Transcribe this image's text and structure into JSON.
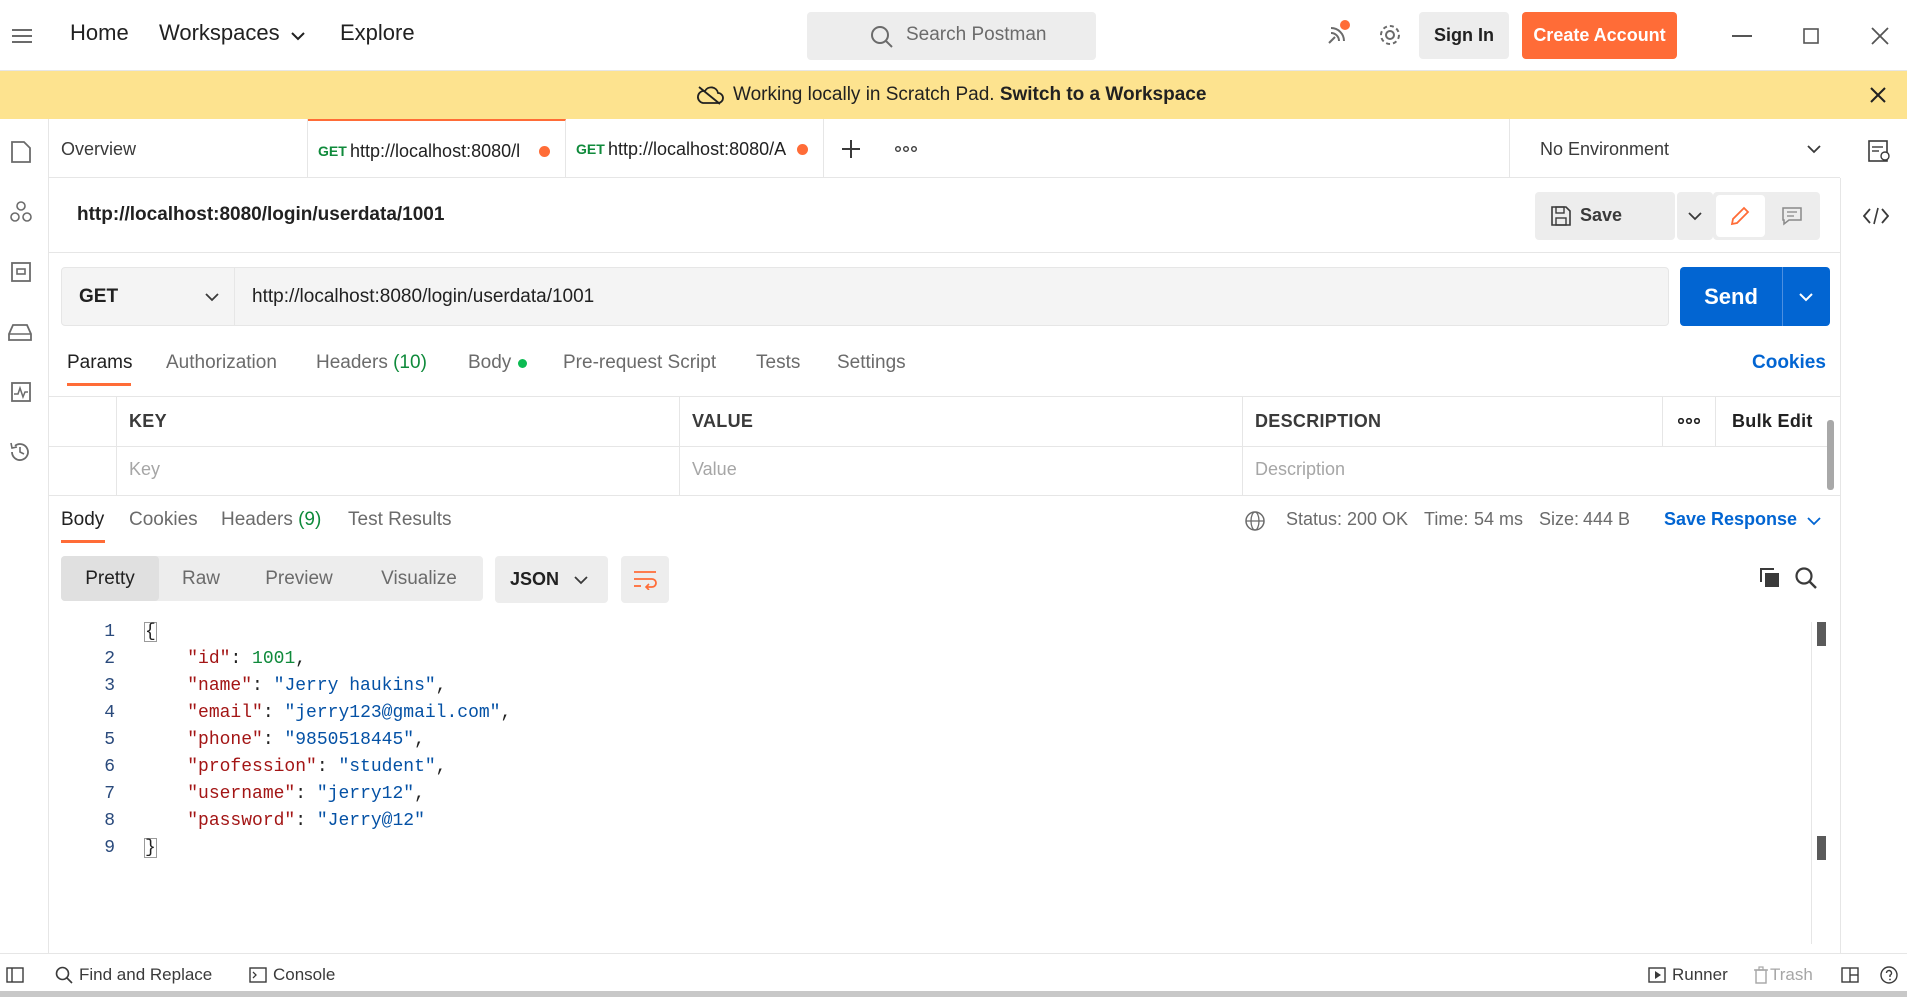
{
  "header": {
    "nav": [
      "Home",
      "Workspaces",
      "Explore"
    ],
    "search_placeholder": "Search Postman",
    "sign_in": "Sign In",
    "create_account": "Create Account"
  },
  "banner": {
    "text": "Working locally in Scratch Pad.",
    "link": "Switch to a Workspace"
  },
  "tabs": {
    "overview": "Overview",
    "items": [
      {
        "method": "GET",
        "url": "http://localhost:8080/l"
      },
      {
        "method": "GET",
        "url": "http://localhost:8080/A"
      }
    ],
    "environment": "No Environment"
  },
  "request": {
    "title": "http://localhost:8080/login/userdata/1001",
    "save": "Save",
    "method": "GET",
    "url": "http://localhost:8080/login/userdata/1001",
    "send": "Send",
    "tabs": {
      "params": "Params",
      "authorization": "Authorization",
      "headers": "Headers",
      "headers_count": "(10)",
      "body": "Body",
      "prerequest": "Pre-request Script",
      "tests": "Tests",
      "settings": "Settings"
    },
    "cookies": "Cookies"
  },
  "params_table": {
    "headers": [
      "KEY",
      "VALUE",
      "DESCRIPTION"
    ],
    "bulk_edit": "Bulk Edit",
    "placeholders": [
      "Key",
      "Value",
      "Description"
    ]
  },
  "response": {
    "tabs": {
      "body": "Body",
      "cookies": "Cookies",
      "headers": "Headers",
      "headers_count": "(9)",
      "test_results": "Test Results"
    },
    "status_label": "Status:",
    "status_value": "200 OK",
    "time_label": "Time:",
    "time_value": "54 ms",
    "size_label": "Size:",
    "size_value": "444 B",
    "save_response": "Save Response",
    "views": [
      "Pretty",
      "Raw",
      "Preview",
      "Visualize"
    ],
    "format": "JSON",
    "line_numbers": [
      "1",
      "2",
      "3",
      "4",
      "5",
      "6",
      "7",
      "8",
      "9"
    ],
    "open_brace": "{",
    "close_brace": "}",
    "body_fields": [
      {
        "key": "\"id\"",
        "value": "1001",
        "type": "number",
        "comma": ","
      },
      {
        "key": "\"name\"",
        "value": "\"Jerry haukins\"",
        "type": "string",
        "comma": ","
      },
      {
        "key": "\"email\"",
        "value": "\"jerry123@gmail.com\"",
        "type": "string",
        "comma": ","
      },
      {
        "key": "\"phone\"",
        "value": "\"9850518445\"",
        "type": "string",
        "comma": ","
      },
      {
        "key": "\"profession\"",
        "value": "\"student\"",
        "type": "string",
        "comma": ","
      },
      {
        "key": "\"username\"",
        "value": "\"jerry12\"",
        "type": "string",
        "comma": ","
      },
      {
        "key": "\"password\"",
        "value": "\"Jerry@12\"",
        "type": "string",
        "comma": ""
      }
    ]
  },
  "statusbar": {
    "find_replace": "Find and Replace",
    "console": "Console",
    "runner": "Runner",
    "trash": "Trash"
  },
  "colors": {
    "accent": "#ff6c37",
    "send_blue": "#0265d2",
    "banner": "#fde38f",
    "success_green": "#0f8a3b"
  }
}
